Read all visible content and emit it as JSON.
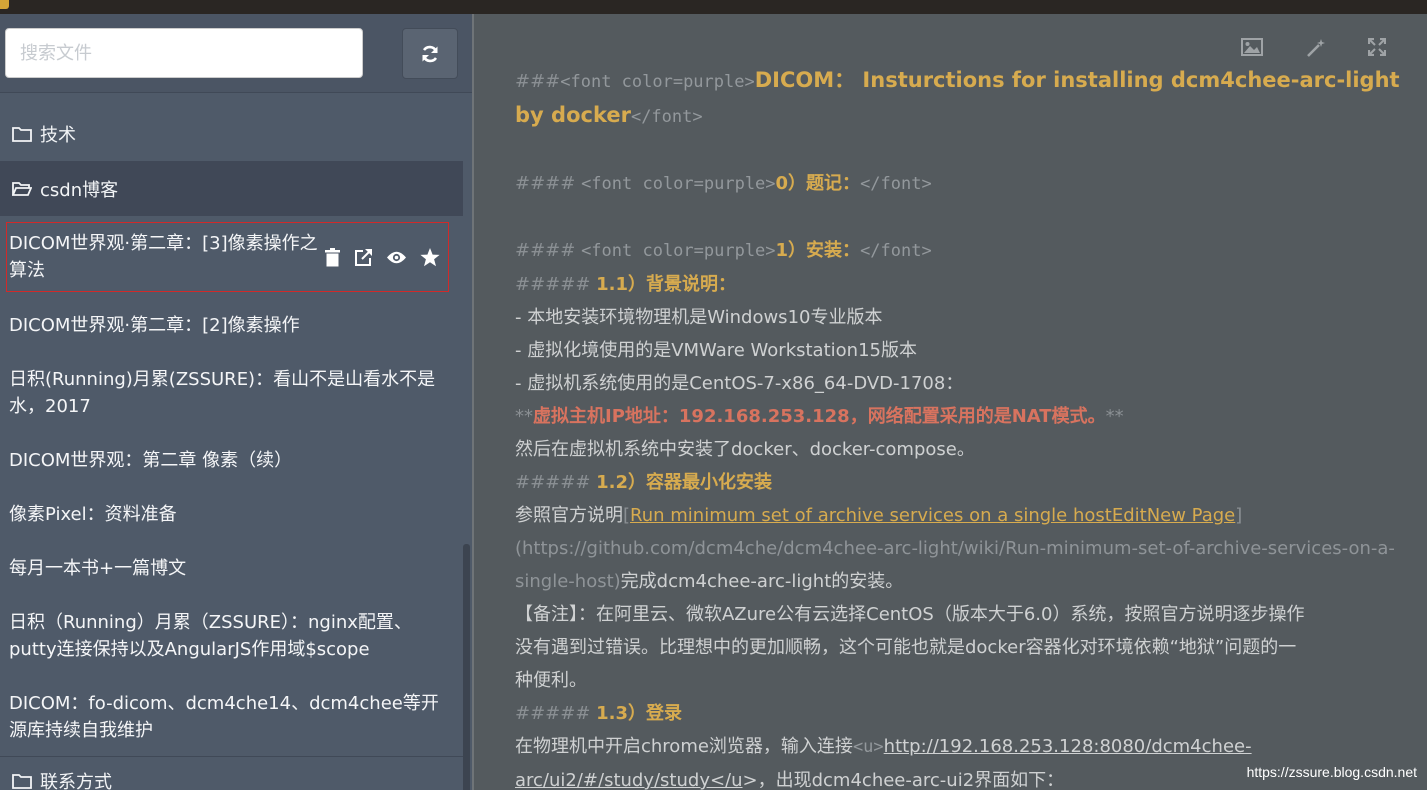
{
  "colors": {
    "accent": "#d7ab4f",
    "selected_border": "#d12a2a",
    "sidebar_bg": "#4f5a69",
    "editor_bg": "#545a5e",
    "bold_red": "#d8735f"
  },
  "search": {
    "placeholder": "搜索文件",
    "refresh_icon": "refresh-icon"
  },
  "sidebar": {
    "folders": {
      "tech": "技术",
      "csdn": "csdn博客",
      "contact": "联系方式"
    },
    "items": [
      {
        "label": "DICOM世界观·第二章：[3]像素操作之算法",
        "selected": true
      },
      {
        "label": "DICOM世界观·第二章：[2]像素操作"
      },
      {
        "label": "日积(Running)月累(ZSSURE)：看山不是山看水不是水，2017"
      },
      {
        "label": "DICOM世界观：第二章 像素（续）"
      },
      {
        "label": "像素Pixel：资料准备"
      },
      {
        "label": "每月一本书+一篇博文"
      },
      {
        "label": "日积（Running）月累（ZSSURE）：nginx配置、putty连接保持以及AngularJS作用域$scope"
      },
      {
        "label": "DICOM：fo-dicom、dcm4che14、dcm4chee等开源库持续自我维护"
      }
    ],
    "item_actions": [
      "trash-icon",
      "external-link-icon",
      "eye-icon",
      "star-icon"
    ]
  },
  "toolbar": {
    "icons": [
      "image-icon",
      "magic-wand-icon",
      "fullscreen-icon"
    ]
  },
  "editor": {
    "l1": {
      "mk": "###",
      "open": "<font color=purple>",
      "text": "DICOM： Insturctions for installing dcm4chee-arc-light"
    },
    "l2": {
      "text": "by docker",
      "close": "</font>"
    },
    "l3": {
      "mk": "####",
      "open": "<font color=purple>",
      "text": "0）题记：",
      "close": "</font>"
    },
    "l4": {
      "mk": "####",
      "open": "<font color=purple>",
      "text": "1）安装：",
      "close": "</font>"
    },
    "l5": {
      "mk": "#####",
      "text": "1.1）背景说明："
    },
    "l6": "- 本地安装环境物理机是Windows10专业版本",
    "l7": "- 虚拟化境使用的是VMWare Workstation15版本",
    "l8": "- 虚拟机系统使用的是CentOS-7-x86_64-DVD-1708：",
    "l9": {
      "mk": "**",
      "text": "虚拟主机IP地址：192.168.253.128，网络配置采用的是NAT模式。",
      "mk2": "**"
    },
    "l10": "然后在虚拟机系统中安装了docker、docker-compose。",
    "l11": {
      "mk": "#####",
      "text": "1.2）容器最小化安装"
    },
    "l12": {
      "pre": "参照官方说明",
      "lb": "[",
      "link": "Run minimum set of archive services on a single hostEditNew Page",
      "rb": "]"
    },
    "l13": "(https://github.com/dcm4che/dcm4chee-arc-light/wiki/Run-minimum-set-of-archive-services-on-a-",
    "l14": {
      "url": "single-host)",
      "text": "完成dcm4chee-arc-light的安装。"
    },
    "l15": "【备注】：在阿里云、微软AZure公有云选择CentOS（版本大于6.0）系统，按照官方说明逐步操作",
    "l16": "没有遇到过错误。比理想中的更加顺畅，这个可能也就是docker容器化对环境依赖“地狱”问题的一",
    "l17": "种便利。",
    "l18": {
      "mk": "#####",
      "text": "1.3）登录"
    },
    "l19": {
      "text": "在物理机中开启chrome浏览器，输入连接",
      "tag": "<u>",
      "link": "http://192.168.253.128:8080/dcm4chee-"
    },
    "l20": {
      "link": "arc/ui2/#/study/study</u",
      "text": ">，出现dcm4chee-arc-ui2界面如下："
    }
  },
  "watermark": "https://zssure.blog.csdn.net"
}
